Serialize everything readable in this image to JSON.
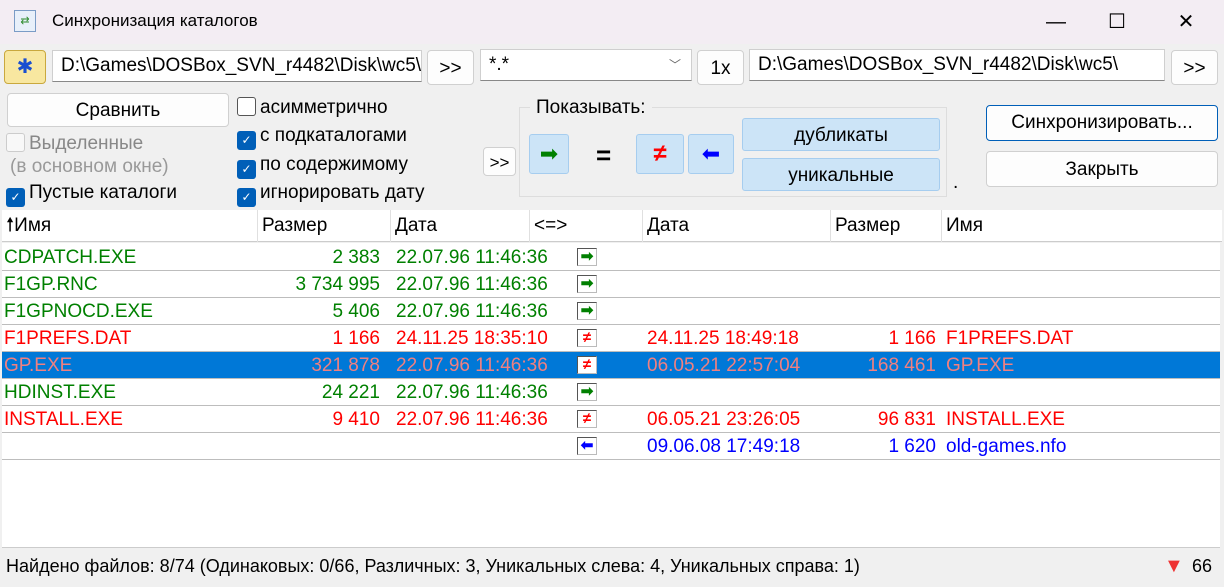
{
  "window": {
    "title": "Синхронизация каталогов",
    "min": "—",
    "max": "☐",
    "close": "✕"
  },
  "toolbar": {
    "left_path": "D:\\Games\\DOSBox_SVN_r4482\\Disk\\wc5\\",
    "browse_left": ">>",
    "mask": "*.*",
    "one_x": "1x",
    "right_path": "D:\\Games\\DOSBox_SVN_r4482\\Disk\\wc5\\",
    "browse_right": ">>"
  },
  "options": {
    "compare": "Сравнить",
    "selected": "Выделенные",
    "selected_note": "(в основном окне)",
    "empty_dirs": "Пустые каталоги",
    "asymmetric": "асимметрично",
    "subdirs": "с подкаталогами",
    "by_content": "по содержимому",
    "ignore_date": "игнорировать дату",
    "more": ">>"
  },
  "show": {
    "label": "Показывать:",
    "equal": "=",
    "duplicates": "дубликаты",
    "unique": "уникальные",
    "dot": "."
  },
  "actions": {
    "sync": "Синхронизировать...",
    "close": "Закрыть"
  },
  "columns": {
    "name_l": "Имя",
    "size_l": "Размер",
    "date_l": "Дата",
    "cmp": "<=>",
    "date_r": "Дата",
    "size_r": "Размер",
    "name_r": "Имя"
  },
  "rows": [
    {
      "name_l": "CDPATCH.EXE",
      "size_l": "2 383",
      "date_l": "22.07.96 11:46:36",
      "cmp": "right",
      "date_r": "",
      "size_r": "",
      "name_r": "",
      "color": "#008000"
    },
    {
      "name_l": "F1GP.RNC",
      "size_l": "3 734 995",
      "date_l": "22.07.96 11:46:36",
      "cmp": "right",
      "date_r": "",
      "size_r": "",
      "name_r": "",
      "color": "#008000"
    },
    {
      "name_l": "F1GPNOCD.EXE",
      "size_l": "5 406",
      "date_l": "22.07.96 11:46:36",
      "cmp": "right",
      "date_r": "",
      "size_r": "",
      "name_r": "",
      "color": "#008000"
    },
    {
      "name_l": "F1PREFS.DAT",
      "size_l": "1 166",
      "date_l": "24.11.25 18:35:10",
      "cmp": "diff",
      "date_r": "24.11.25 18:49:18",
      "size_r": "1 166",
      "name_r": "F1PREFS.DAT",
      "color": "#ff0000"
    },
    {
      "name_l": "GP.EXE",
      "size_l": "321 878",
      "date_l": "22.07.96 11:46:36",
      "cmp": "diff",
      "date_r": "06.05.21 22:57:04",
      "size_r": "168 461",
      "name_r": "GP.EXE",
      "color": "#ff0000",
      "selected": true
    },
    {
      "name_l": "HDINST.EXE",
      "size_l": "24 221",
      "date_l": "22.07.96 11:46:36",
      "cmp": "right",
      "date_r": "",
      "size_r": "",
      "name_r": "",
      "color": "#008000"
    },
    {
      "name_l": "INSTALL.EXE",
      "size_l": "9 410",
      "date_l": "22.07.96 11:46:36",
      "cmp": "diff",
      "date_r": "06.05.21 23:26:05",
      "size_r": "96 831",
      "name_r": "INSTALL.EXE",
      "color": "#ff0000"
    },
    {
      "name_l": "",
      "size_l": "",
      "date_l": "",
      "cmp": "left",
      "date_r": "09.06.08 17:49:18",
      "size_r": "1 620",
      "name_r": "old-games.nfo",
      "color": "#0000ff"
    }
  ],
  "status": {
    "text": "Найдено файлов: 8/74  (Одинаковых: 0/66, Различных: 3, Уникальных слева: 4, Уникальных справа: 1)",
    "count": "66"
  }
}
